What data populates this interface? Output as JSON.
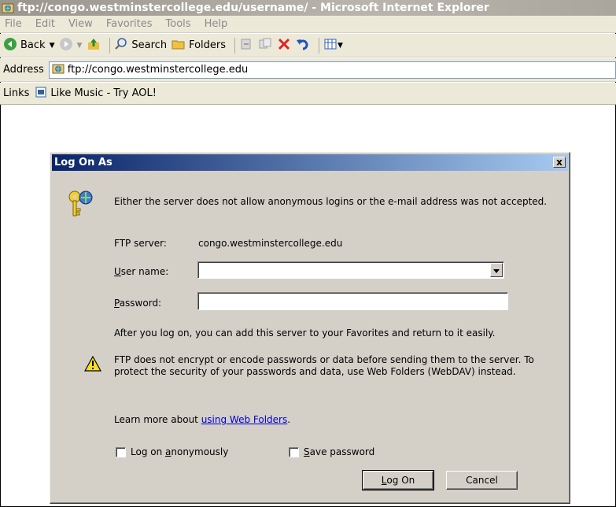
{
  "window": {
    "title": "ftp://congo.westminstercollege.edu/username/ - Microsoft Internet Explorer"
  },
  "menu": [
    "File",
    "Edit",
    "View",
    "Favorites",
    "Tools",
    "Help"
  ],
  "toolbar": {
    "back_label": "Back",
    "search_label": "Search",
    "folders_label": "Folders"
  },
  "address": {
    "label": "Address",
    "value": "ftp://congo.westminstercollege.edu"
  },
  "links": {
    "label": "Links",
    "item": "Like Music - Try AOL!"
  },
  "dialog": {
    "title": "Log On As",
    "close_glyph": "x",
    "message": "Either the server does not allow anonymous logins or the e-mail address was not accepted.",
    "ftp_server_label": "FTP server:",
    "ftp_server_value": "congo.westminstercollege.edu",
    "username_label_u": "U",
    "username_label_rest": "ser name:",
    "username_value": "",
    "password_label_u": "P",
    "password_label_rest": "assword:",
    "password_value": "",
    "favorites_note": "After you log on, you can add this server to your Favorites and return to it easily.",
    "warning_text": "FTP does not encrypt or encode passwords or data before sending them to the server.  To protect the security of your passwords and data, use Web Folders (WebDAV) instead.",
    "learn_more_prefix": "Learn more about ",
    "learn_more_link": "using Web Folders",
    "learn_more_suffix": ".",
    "anon_label_pre": "Log on ",
    "anon_label_u": "a",
    "anon_label_rest": "nonymously",
    "anon_checked": false,
    "save_label_u": "S",
    "save_label_rest": "ave password",
    "save_checked": false,
    "logon_label_u": "L",
    "logon_label_rest": "og On",
    "cancel_label": "Cancel"
  },
  "icons": {
    "window": "ie-ftp-icon",
    "back": "back-arrow-icon",
    "forward": "forward-arrow-icon",
    "up": "up-folder-icon",
    "search": "search-icon",
    "folders": "folders-icon",
    "move_to": "move-to-icon",
    "copy_to": "copy-to-icon",
    "delete": "delete-icon",
    "undo": "undo-icon",
    "views": "views-icon",
    "keys": "keys-icon",
    "warning": "warning-icon"
  },
  "colors": {
    "dialog_title_start": "#0a246a",
    "dialog_title_end": "#a6caf0",
    "link": "#0000cc",
    "delete_red": "#e02020"
  }
}
